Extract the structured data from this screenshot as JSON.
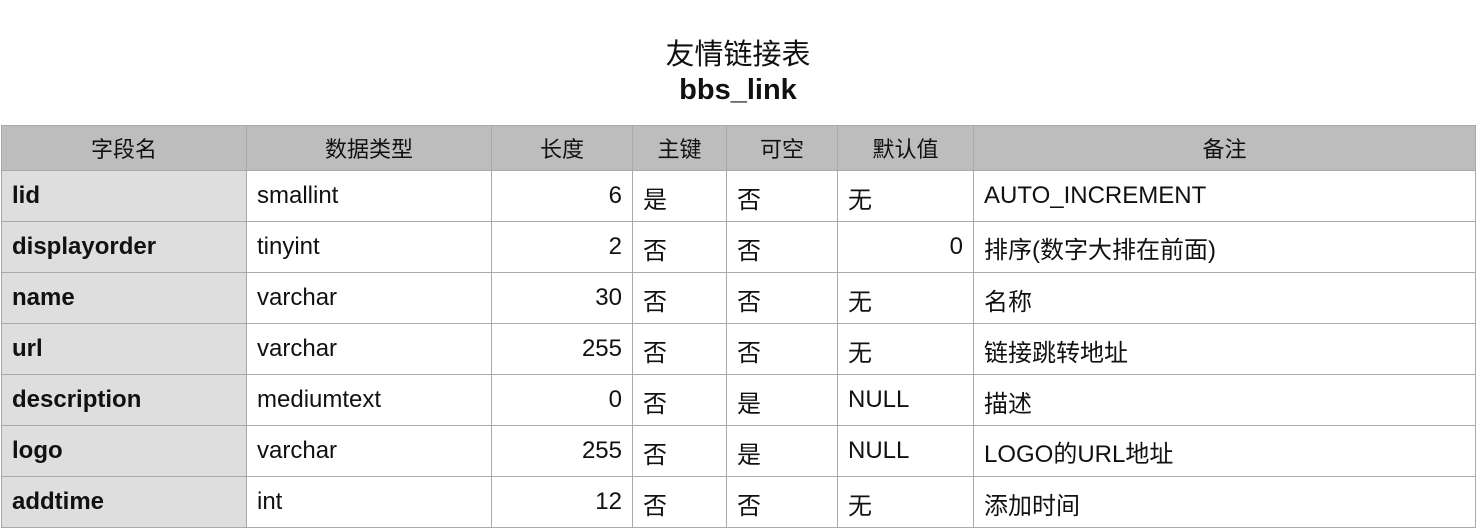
{
  "title": {
    "cn": "友情链接表",
    "en": "bbs_link"
  },
  "table": {
    "headers": {
      "field": "字段名",
      "type": "数据类型",
      "length": "长度",
      "pk": "主键",
      "nullable": "可空",
      "default": "默认值",
      "note": "备注"
    },
    "rows": [
      {
        "field": "lid",
        "type": "smallint",
        "length": "6",
        "pk": "是",
        "nullable": "否",
        "default": "无",
        "note": "AUTO_INCREMENT"
      },
      {
        "field": "displayorder",
        "type": "tinyint",
        "length": "2",
        "pk": "否",
        "nullable": "否",
        "default": "0",
        "note": "排序(数字大排在前面)"
      },
      {
        "field": "name",
        "type": "varchar",
        "length": "30",
        "pk": "否",
        "nullable": "否",
        "default": "无",
        "note": "名称"
      },
      {
        "field": "url",
        "type": "varchar",
        "length": "255",
        "pk": "否",
        "nullable": "否",
        "default": "无",
        "note": "链接跳转地址"
      },
      {
        "field": "description",
        "type": "mediumtext",
        "length": "0",
        "pk": "否",
        "nullable": "是",
        "default": "NULL",
        "note": "描述"
      },
      {
        "field": "logo",
        "type": "varchar",
        "length": "255",
        "pk": "否",
        "nullable": "是",
        "default": "NULL",
        "note": "LOGO的URL地址"
      },
      {
        "field": "addtime",
        "type": "int",
        "length": "12",
        "pk": "否",
        "nullable": "否",
        "default": "无",
        "note": "添加时间"
      }
    ]
  }
}
